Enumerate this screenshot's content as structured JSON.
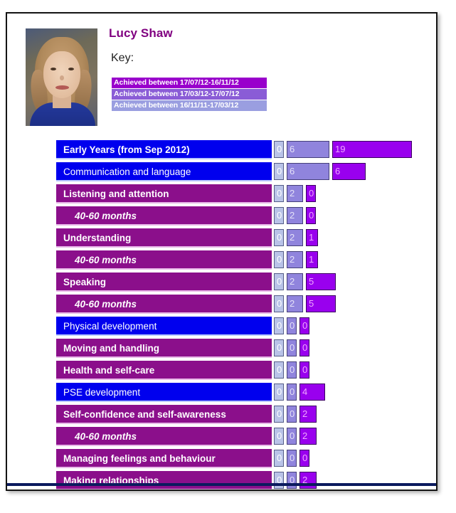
{
  "card": {
    "pupil_name": "Lucy Shaw",
    "photo_alt": "pupil-photo",
    "key_title": "Key:",
    "key_items": [
      {
        "label": "Achieved between 17/07/12-16/11/12",
        "color": "#9900cc"
      },
      {
        "label": "Achieved between 17/03/12-17/07/12",
        "color": "#8a5cd6"
      },
      {
        "label": "Achieved between 16/11/11-17/03/12",
        "color": "#9a9ee0"
      }
    ]
  },
  "chart_data": {
    "type": "bar",
    "title": "Lucy Shaw",
    "orientation": "horizontal",
    "stacked": false,
    "grid": false,
    "legend_position": "top",
    "xlabel": "",
    "ylabel": "",
    "series": [
      {
        "name": "Achieved between 16/11/11-17/03/12",
        "color": "#b9c3e8",
        "values": [
          0,
          0,
          0,
          0,
          0,
          0,
          0,
          0,
          0,
          0,
          0,
          0,
          0,
          0,
          0,
          0
        ]
      },
      {
        "name": "Achieved between 17/03/12-17/07/12",
        "color": "#9084dd",
        "values": [
          6,
          6,
          2,
          2,
          2,
          2,
          2,
          2,
          0,
          0,
          0,
          0,
          0,
          0,
          0,
          0
        ]
      },
      {
        "name": "Achieved between 17/07/12-16/11/12",
        "color": "#9900ee",
        "values": [
          19,
          6,
          0,
          0,
          1,
          1,
          5,
          5,
          0,
          0,
          0,
          4,
          2,
          2,
          0,
          2
        ]
      }
    ],
    "categories": [
      "Early Years (from Sep 2012)",
      "Communication and language",
      "Listening and attention",
      "40-60 months",
      "Understanding",
      "40-60 months",
      "Speaking",
      "40-60 months",
      "Physical development",
      "Moving and handling",
      "Health and self-care",
      "PSE development",
      "Self-confidence and self-awareness",
      "40-60 months",
      "Managing feelings and behaviour",
      "Making relationships"
    ],
    "rows": [
      {
        "label": "Early Years (from Sep 2012)",
        "tone": "blue",
        "level": 0,
        "values": [
          0,
          6,
          19
        ],
        "widths": [
          14,
          60,
          112
        ]
      },
      {
        "label": "Communication and language",
        "tone": "blue",
        "level": 1,
        "values": [
          0,
          6,
          6
        ],
        "widths": [
          14,
          60,
          47
        ]
      },
      {
        "label": "Listening and attention",
        "tone": "purple",
        "level": 2,
        "values": [
          0,
          2,
          0
        ],
        "widths": [
          14,
          23,
          14
        ]
      },
      {
        "label": "40-60 months",
        "tone": "purple",
        "level": 3,
        "values": [
          0,
          2,
          0
        ],
        "widths": [
          14,
          23,
          14
        ]
      },
      {
        "label": "Understanding",
        "tone": "purple",
        "level": 2,
        "values": [
          0,
          2,
          1
        ],
        "widths": [
          14,
          23,
          17
        ]
      },
      {
        "label": "40-60 months",
        "tone": "purple",
        "level": 3,
        "values": [
          0,
          2,
          1
        ],
        "widths": [
          14,
          23,
          17
        ]
      },
      {
        "label": "Speaking",
        "tone": "purple",
        "level": 2,
        "values": [
          0,
          2,
          5
        ],
        "widths": [
          14,
          23,
          42
        ]
      },
      {
        "label": "40-60 months",
        "tone": "purple",
        "level": 3,
        "values": [
          0,
          2,
          5
        ],
        "widths": [
          14,
          23,
          42
        ]
      },
      {
        "label": "Physical development",
        "tone": "blue",
        "level": 1,
        "values": [
          0,
          0,
          0
        ],
        "widths": [
          14,
          14,
          14
        ]
      },
      {
        "label": "Moving and handling",
        "tone": "purple",
        "level": 2,
        "values": [
          0,
          0,
          0
        ],
        "widths": [
          14,
          14,
          14
        ]
      },
      {
        "label": "Health and self-care",
        "tone": "purple",
        "level": 2,
        "values": [
          0,
          0,
          0
        ],
        "widths": [
          14,
          14,
          14
        ]
      },
      {
        "label": "PSE development",
        "tone": "blue",
        "level": 1,
        "values": [
          0,
          0,
          4
        ],
        "widths": [
          14,
          14,
          36
        ]
      },
      {
        "label": "Self-confidence and self-awareness",
        "tone": "purple",
        "level": 2,
        "values": [
          0,
          0,
          2
        ],
        "widths": [
          14,
          14,
          24
        ]
      },
      {
        "label": "40-60 months",
        "tone": "purple",
        "level": 3,
        "values": [
          0,
          0,
          2
        ],
        "widths": [
          14,
          14,
          24
        ]
      },
      {
        "label": "Managing feelings and behaviour",
        "tone": "purple",
        "level": 2,
        "values": [
          0,
          0,
          0
        ],
        "widths": [
          14,
          14,
          14
        ]
      },
      {
        "label": "Making relationships",
        "tone": "purple",
        "level": 2,
        "values": [
          0,
          0,
          2
        ],
        "widths": [
          14,
          14,
          24
        ]
      }
    ]
  }
}
